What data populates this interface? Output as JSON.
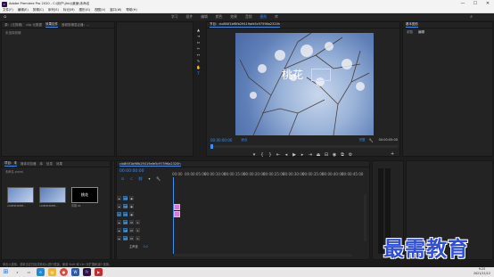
{
  "titlebar": {
    "title": "Adobe Premiere Pro 2020 - C:\\用户\\(hb)\\桌面\\未命名",
    "min": "—",
    "max": "☐",
    "close": "✕"
  },
  "menu": [
    "文件(F)",
    "编辑(E)",
    "剪辑(C)",
    "序列(S)",
    "标记(M)",
    "图形(G)",
    "视图(V)",
    "窗口(W)",
    "帮助(H)"
  ],
  "workspaces": [
    "学习",
    "组件",
    "编辑",
    "颜色",
    "效果",
    "音频",
    "图形",
    "库"
  ],
  "workspace_active_index": 6,
  "source_panel": {
    "tabs": [
      "源：(无剪辑)",
      "clip 元数据",
      "效果控件",
      "音频剪辑混合器：..."
    ],
    "search_placeholder": "未选择剪辑"
  },
  "program_monitor": {
    "tab": "节目：clo8f4f1bf6fb29419afe5c97596a2320h",
    "overlay_text": "桃花",
    "timecode_left": "00:00:00:00",
    "fit": "适合",
    "quality": "完整",
    "timecode_right": "00:00:05:00"
  },
  "right_panel": {
    "title": "基本图形",
    "tabs": [
      "浏览",
      "编辑"
    ]
  },
  "project_panel": {
    "tabs": [
      "项目：未",
      "媒体浏览器",
      "库",
      "信息",
      "效果"
    ],
    "path": "未命名.prproj",
    "items": [
      {
        "name": "clo8f4f1bf6f...",
        "dur": "5:00"
      },
      {
        "name": "clo8f4f1bf6f...",
        "dur": "5:00"
      },
      {
        "name": "字幕 01",
        "dur": "5:00"
      }
    ],
    "thumb3_text": "桃花"
  },
  "timeline": {
    "tab": "clo8f4f1bf6fb29419afe5c97596a2320h",
    "timecode": "00:00:00:00",
    "ruler": [
      "00:00",
      "00:00:05:00",
      "00:00:10:00",
      "00:00:15:00",
      "00:00:20:00",
      "00:00:25:00",
      "00:00:30:00",
      "00:00:35:00",
      "00:00:40:00",
      "00:00:45:00",
      "00:00:50:00",
      "00:00:55:00",
      "00:01:00:00",
      "00:01:05:00"
    ],
    "tracks": [
      {
        "name": "V3",
        "type": "video"
      },
      {
        "name": "V2",
        "type": "video"
      },
      {
        "name": "V1",
        "type": "video"
      },
      {
        "name": "A1",
        "type": "audio"
      },
      {
        "name": "A2",
        "type": "audio"
      },
      {
        "name": "A3",
        "type": "audio"
      }
    ],
    "master": "主声道",
    "master_value": "0.0"
  },
  "status": {
    "text": "单击以选择，或单击空白处并拖动以进行框选。使用 Shift 和 Ctrl 可扩展和减少选择。"
  },
  "taskbar": {
    "time": "9:25",
    "date": "2021/11/12"
  },
  "watermark": "最需教育",
  "colors": {
    "accent": "#3b8ff0",
    "clip_pink": "#d97ad9",
    "watermark": "#2f4fd6"
  }
}
